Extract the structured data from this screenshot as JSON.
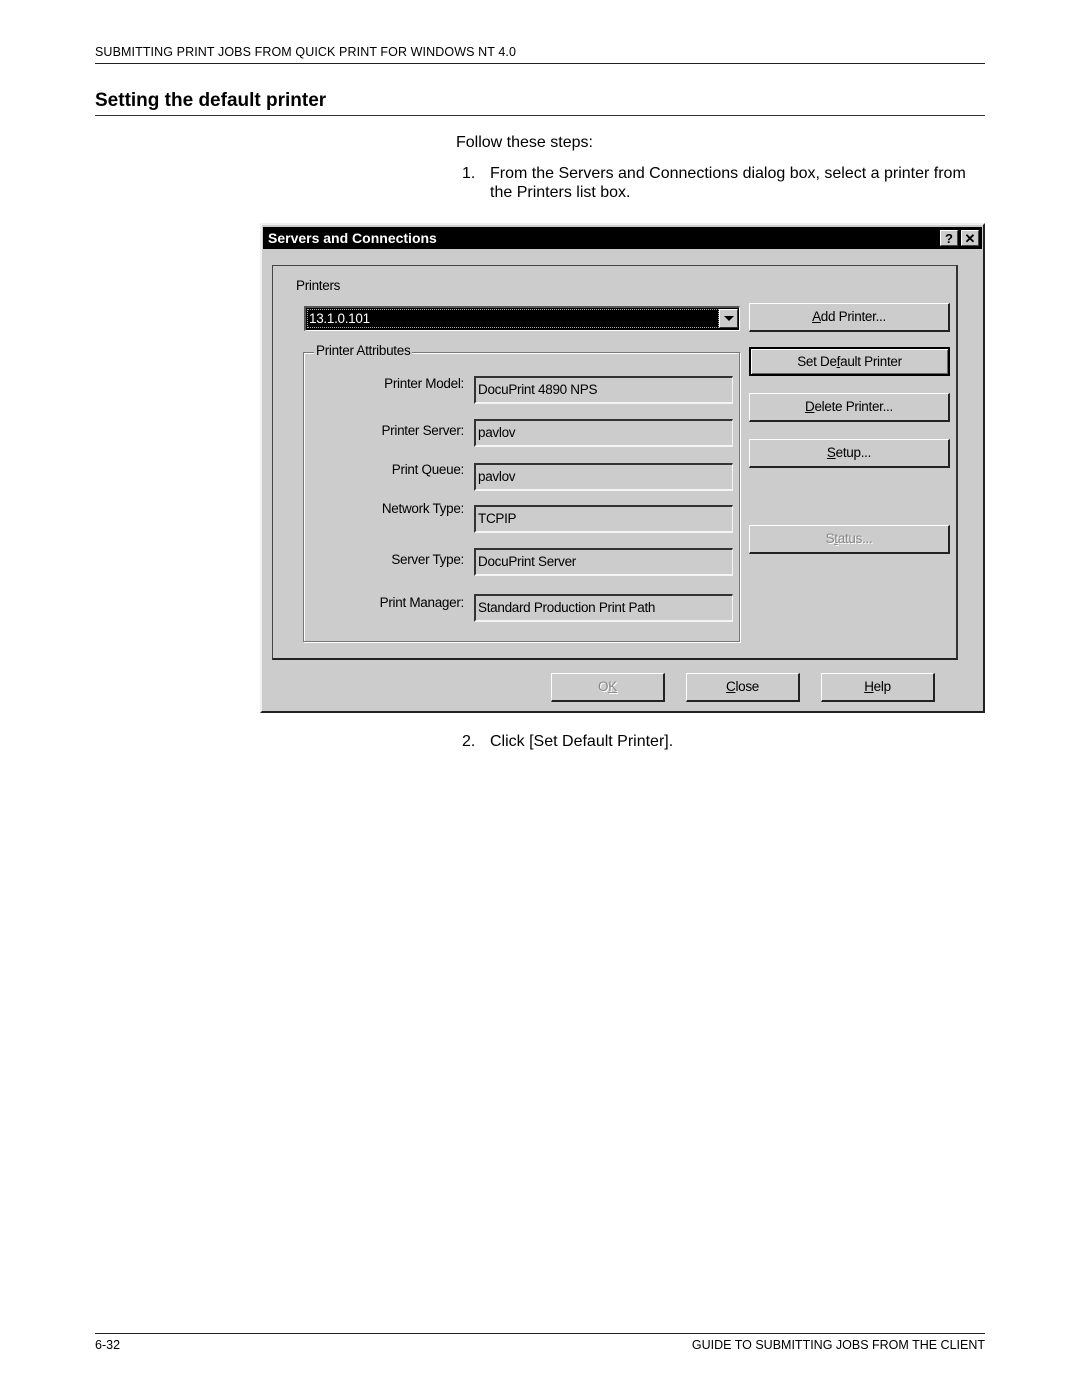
{
  "page": {
    "running_header": "SUBMITTING PRINT JOBS FROM QUICK PRINT FOR WINDOWS NT 4.0",
    "section_title": "Setting the default printer",
    "intro": "Follow these steps:",
    "steps": [
      {
        "number": "1.",
        "text": "From the Servers and Connections dialog box, select a printer from the Printers list box."
      },
      {
        "number": "2.",
        "text": "Click [Set Default Printer]."
      }
    ],
    "footer": {
      "page_number": "6-32",
      "guide_title": "GUIDE TO SUBMITTING JOBS FROM THE CLIENT"
    }
  },
  "dialog": {
    "title": "Servers and Connections",
    "title_buttons": {
      "help": "?",
      "close": "✕"
    },
    "printers_label": "Printers",
    "printers_selected": "13.1.0.101",
    "attributes_group_label": "Printer Attributes",
    "attributes": [
      {
        "label": "Printer Model:",
        "value": "DocuPrint 4890 NPS"
      },
      {
        "label": "Printer Server:",
        "value": "pavlov"
      },
      {
        "label": "Print Queue:",
        "value": "pavlov"
      },
      {
        "label": "Network Type:",
        "value": "TCPIP"
      },
      {
        "label": "Server Type:",
        "value": "DocuPrint Server"
      },
      {
        "label": "Print Manager:",
        "value": "Standard Production Print Path"
      }
    ],
    "side_buttons": {
      "add_printer": {
        "pre": "",
        "accel": "A",
        "post": "dd Printer..."
      },
      "set_default": {
        "pre": "Set De",
        "accel": "f",
        "post": "ault Printer"
      },
      "delete_printer": {
        "pre": "",
        "accel": "D",
        "post": "elete Printer..."
      },
      "setup": {
        "pre": "",
        "accel": "S",
        "post": "etup..."
      },
      "status": {
        "pre": "S",
        "accel": "t",
        "post": "atus..."
      }
    },
    "footer_buttons": {
      "ok": {
        "pre": "O",
        "accel": "K",
        "post": ""
      },
      "close": {
        "pre": "",
        "accel": "C",
        "post": "lose"
      },
      "help": {
        "pre": "",
        "accel": "H",
        "post": "elp"
      }
    }
  }
}
